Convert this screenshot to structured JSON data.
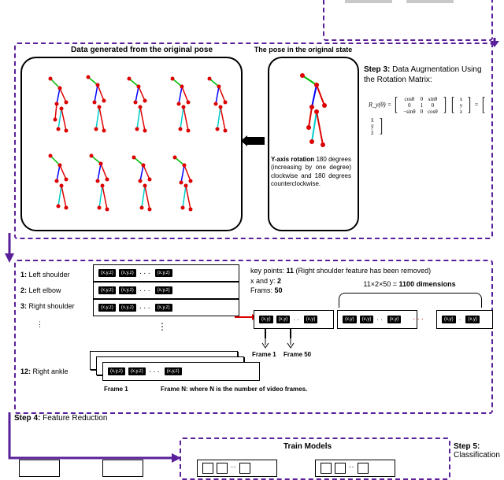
{
  "top_images_count": 2,
  "step3": {
    "label_bold": "Step 3:",
    "label_text": " Data Augmentation Using the Rotation Matrix:",
    "gen_title": "Data generated from the original pose",
    "orig_title": "The pose in the original state",
    "rotation_note_bold": "Y-axis rotation",
    "rotation_note_rest": " 180 degrees (increasing by one degree) clockwise and 180 degrees counterclockwise.",
    "formula_lhs": "R_y(θ) =",
    "matrix": [
      [
        "cosθ",
        "0",
        "sinθ"
      ],
      [
        "0",
        "1",
        "0"
      ],
      [
        "−sinθ",
        "0",
        "cosθ"
      ]
    ],
    "vec_in": [
      "x",
      "y",
      "z"
    ],
    "vec_out": [
      "x̂",
      "ŷ",
      "ẑ"
    ]
  },
  "step4": {
    "label_bold": "Step 4:",
    "label_text": " Feature Reduction",
    "joints": [
      {
        "n": "1:",
        "name": "Left shoulder"
      },
      {
        "n": "2:",
        "name": "Left elbow"
      },
      {
        "n": "3:",
        "name": "Right shoulder"
      },
      {
        "n": "12:",
        "name": "Right ankle"
      }
    ],
    "cell": "(x,y,z)",
    "xy_cell": "(x,y)",
    "frame1": "Frame 1",
    "frameN_caption": "Frame N: where N is the number of video frames.",
    "frame50": "Frame 50",
    "info_line1_pre": "key points: ",
    "info_line1_bold": "11",
    "info_line1_post": " (Right shoulder feature has been removed)",
    "info_line2_pre": "x and y: ",
    "info_line2_bold": "2",
    "info_line3_pre": "Frams: ",
    "info_line3_bold": "50",
    "dim_expr": "11×2×50 = ",
    "dim_bold": "1100 dimensions"
  },
  "step5": {
    "train_title": "Train Models",
    "label_bold": "Step 5:",
    "label_text": " Classification"
  }
}
